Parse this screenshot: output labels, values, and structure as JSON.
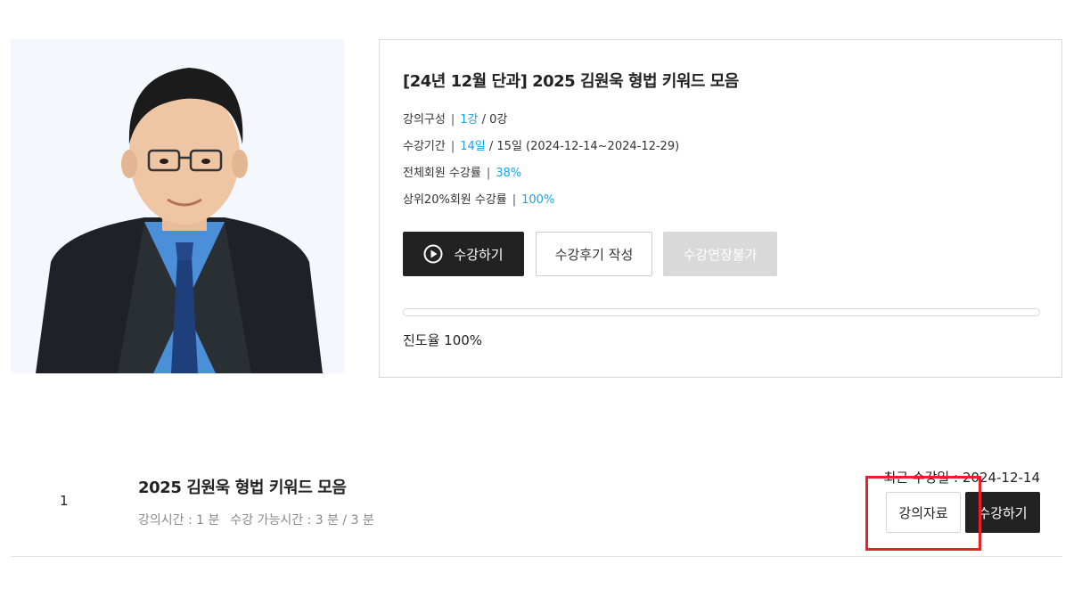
{
  "course": {
    "title": "[24년 12월 단과] 2025 김원욱 형법 키워드 모음",
    "composition": {
      "label": "강의구성",
      "current": "1강",
      "rest": "/ 0강"
    },
    "period": {
      "label": "수강기간",
      "current": "14일",
      "rest": "/ 15일 (2024-12-14~2024-12-29)"
    },
    "all_rate": {
      "label": "전체회원 수강률",
      "value": "38%"
    },
    "top_rate": {
      "label": "상위20%회원 수강률",
      "value": "100%"
    },
    "separator": "|",
    "buttons": {
      "watch": "수강하기",
      "review": "수강후기 작성",
      "extend": "수강연장불가"
    },
    "progress_text": "진도율 100%",
    "progress_value": 1.0
  },
  "lecture": {
    "number": "1",
    "title": "2025 김원욱 형법 키워드 모음",
    "duration": "강의시간 : 1 분",
    "available": "수강 가능시간 : 3 분 / 3 분",
    "recent": "최근 수강일 : 2024-12-14",
    "material_button": "강의자료",
    "watch_button": "수강하기"
  },
  "colors": {
    "accent": "#1aa3e8",
    "dark": "#222222",
    "disabled": "#d9d9d9",
    "highlight": "#e8202a"
  },
  "icons": {
    "play": "play-circle-icon"
  }
}
